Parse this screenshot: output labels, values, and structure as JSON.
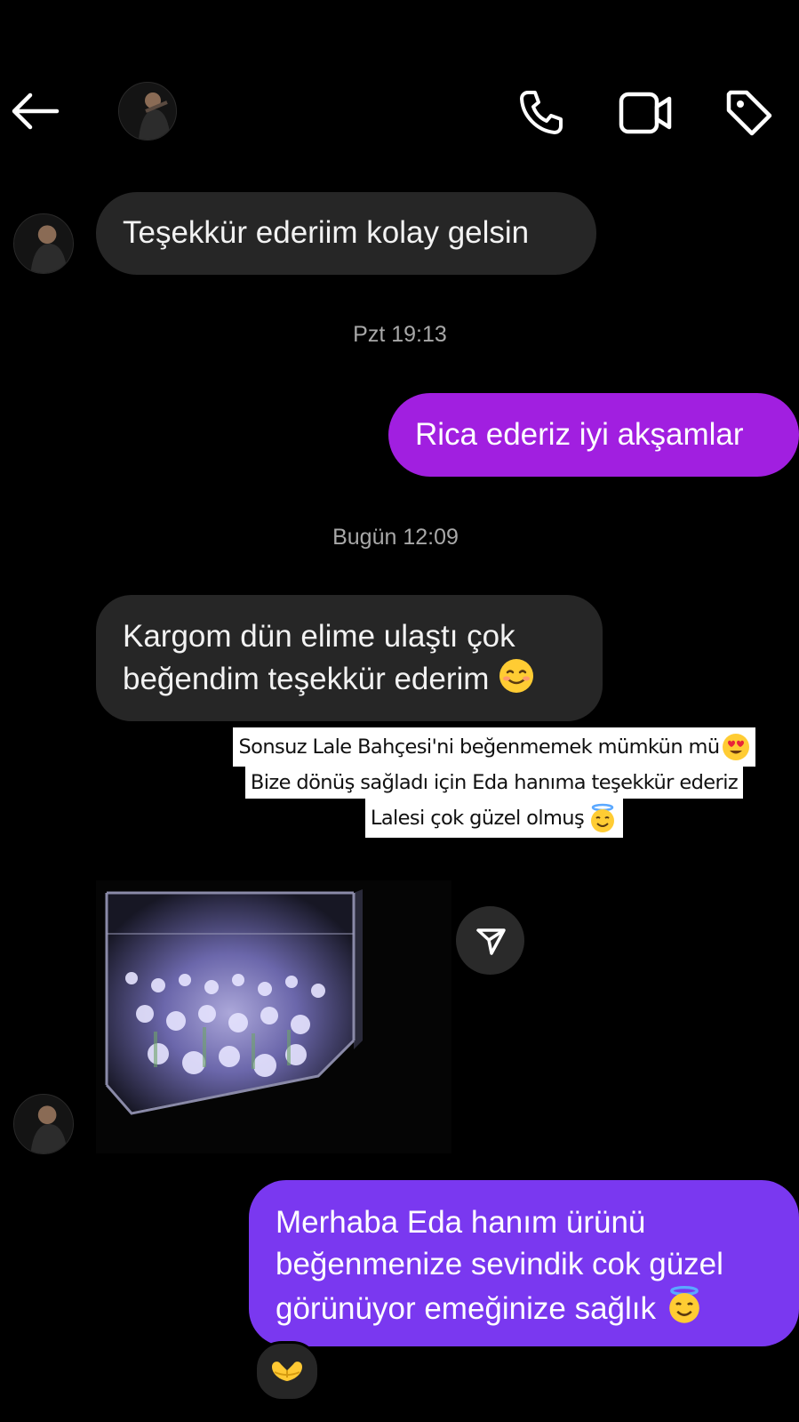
{
  "header": {
    "back_icon": "arrow-left-icon",
    "call_icon": "phone-icon",
    "video_icon": "video-camera-icon",
    "tag_icon": "tag-icon"
  },
  "messages": {
    "m1": "Teşekkür ederiim kolay gelsin",
    "stamp1": "Pzt 19:13",
    "m2": "Rica ederiz iyi akşamlar",
    "stamp2": "Bugün 12:09",
    "m3_line1": "Kargom dün elime ulaştı çok",
    "m3_line2": "beğendim teşekkür ederim",
    "caption_line1": "Sonsuz Lale Bahçesi'ni beğenmemek mümkün mü",
    "caption_line2": "Bize dönüş sağladı için Eda hanıma teşekkür ederiz",
    "caption_line3": "Lalesi çok güzel olmuş",
    "m4_line1": "Merhaba Eda hanım ürünü",
    "m4_line2": "beğenmenize sevindik cok güzel",
    "m4_line3": "görünüyor emeğinize sağlık"
  },
  "colors": {
    "outgoing_1": "#a11fe0",
    "outgoing_2": "#7a38f0",
    "incoming": "#262626"
  },
  "icons": {
    "share": "paper-plane-icon",
    "reaction": "heart-hands-icon"
  }
}
